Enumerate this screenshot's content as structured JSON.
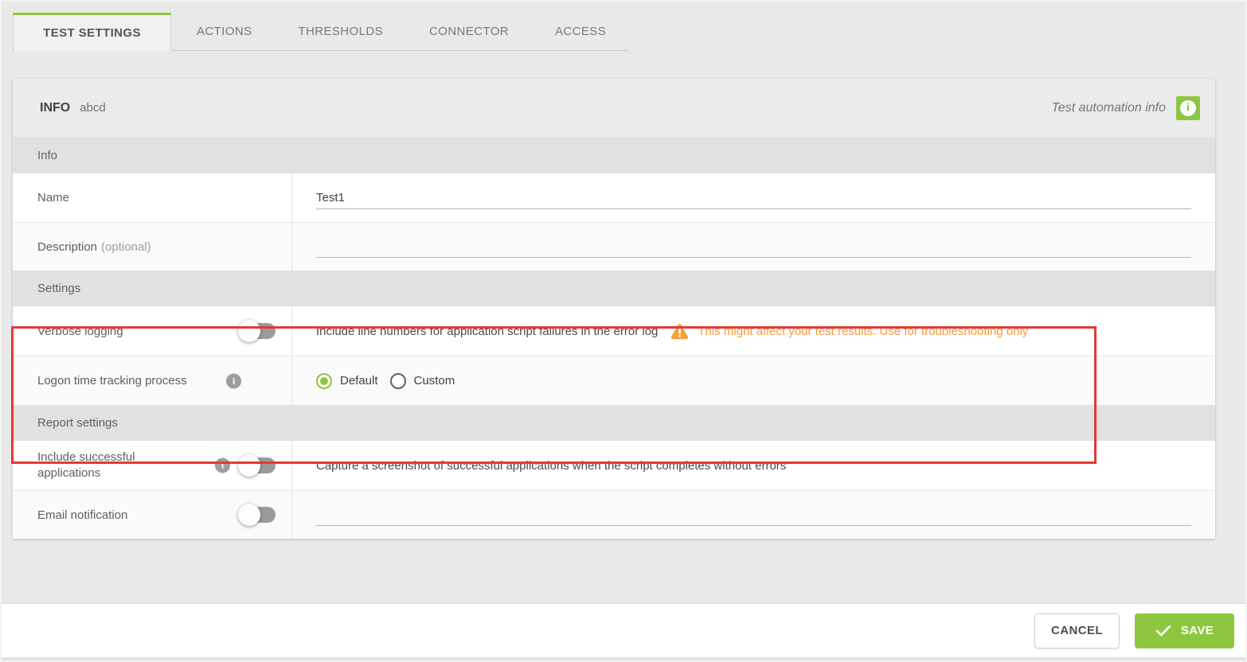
{
  "tabs": [
    {
      "label": "TEST SETTINGS",
      "active": true
    },
    {
      "label": "ACTIONS",
      "active": false
    },
    {
      "label": "THRESHOLDS",
      "active": false
    },
    {
      "label": "CONNECTOR",
      "active": false
    },
    {
      "label": "ACCESS",
      "active": false
    }
  ],
  "panel": {
    "title": "INFO",
    "title_suffix": "abcd",
    "automation_info_label": "Test automation info",
    "automation_info_icon": "info-icon"
  },
  "sections": {
    "info": {
      "heading": "Info",
      "name": {
        "label": "Name",
        "value": "Test1",
        "placeholder": ""
      },
      "description": {
        "label": "Description",
        "optional": "(optional)",
        "value": "",
        "placeholder": ""
      }
    },
    "settings": {
      "heading": "Settings",
      "verbose": {
        "label": "Verbose logging",
        "toggle_state": "off",
        "help": "Include line numbers for application script failures in the error log",
        "warning": "This might affect your test results. Use for troubleshooting only"
      },
      "logon": {
        "label": "Logon time tracking process",
        "info_icon": "info-icon",
        "options": [
          {
            "label": "Default",
            "selected": true
          },
          {
            "label": "Custom",
            "selected": false
          }
        ]
      }
    },
    "report": {
      "heading": "Report settings",
      "include_successful": {
        "label": "Include successful applications",
        "info_icon": "info-icon",
        "toggle_state": "off",
        "help": "Capture a screenshot of successful applications when the script completes without errors"
      },
      "email": {
        "label": "Email notification",
        "toggle_state": "off",
        "value": "",
        "placeholder": ""
      }
    }
  },
  "footer": {
    "cancel_label": "CANCEL",
    "save_label": "SAVE",
    "save_icon": "checkmark-icon"
  },
  "annotations": {
    "highlight": "red-rectangle-around-settings-section"
  },
  "colors": {
    "accent_green": "#8dc63f",
    "warning_orange": "#f8993b",
    "highlight_red": "#e53935",
    "panel_header_bg": "#ebebeb",
    "subheader_bg": "#e1e1e1"
  }
}
